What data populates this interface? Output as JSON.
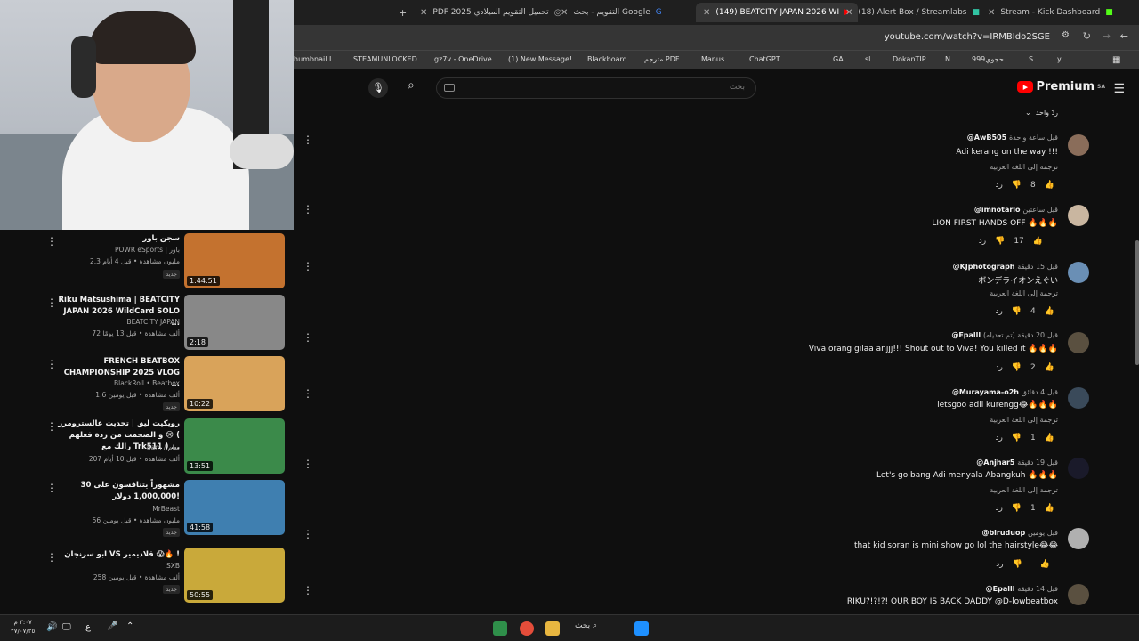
{
  "browser": {
    "tabs": [
      {
        "label": "PDF 2025 تحميل التقويم الميلادي",
        "close": "✕"
      },
      {
        "label": "التقويم - بحث Google",
        "close": "✕"
      },
      {
        "label": "(149) BEATCITY JAPAN 2026 WI",
        "close": "✕"
      },
      {
        "label": "(18) Alert Box / Streamlabs",
        "close": "✕"
      },
      {
        "label": "Stream - Kick Dashboard",
        "close": "✕"
      }
    ],
    "new_tab": "+",
    "url": "youtube.com/watch?v=IRMBIdo2SGE",
    "bookmarks": [
      "humbnail I...",
      "STEAMUNLOCKED",
      "gz7v - OneDrive",
      "(1) New Message!",
      "Blackboard",
      "مترجم PDF",
      "Manus",
      "ChatGPT",
      "GA",
      "sl",
      "DokanTIP",
      "N",
      "999حجوي",
      "S",
      "y"
    ]
  },
  "youtube": {
    "search_placeholder": "بحث",
    "logo_text": "Premium",
    "logo_region": "SA",
    "replies_toggle": "ردّ واحد",
    "comments": [
      {
        "author": "@AwB505",
        "time": "قبل ساعة واحدة",
        "text": "Adi kerang on the way !!!",
        "translate": "ترجمة إلى اللغة العربية",
        "likes": "8",
        "reply": "رد",
        "avatar_color": "#8a6d5a"
      },
      {
        "author": "@imnotarlo",
        "time": "قبل ساعتين",
        "text": "LION FIRST HANDS OFF 🔥🔥🔥",
        "translate": "",
        "likes": "17",
        "reply": "رد",
        "avatar_color": "#c9b6a0"
      },
      {
        "author": "@KJphotograph",
        "time": "قبل 15 دقيقة",
        "text": "ボンデライオンえぐい",
        "translate": "ترجمة إلى اللغة العربية",
        "likes": "4",
        "reply": "رد",
        "avatar_color": "#6a8fb5"
      },
      {
        "author": "@Epalll",
        "time": "قبل 20 دقيقة (تم تعديله)",
        "text": "Viva orang gilaa anjjj!!! Shout out to Viva! You killed it 🔥🔥🔥",
        "translate": "",
        "likes": "2",
        "reply": "رد",
        "avatar_color": "#5a5040"
      },
      {
        "author": "@Murayama-o2h",
        "time": "قبل 4 دقائق",
        "text": "letsgoo adii kurengg😂🔥🔥🔥",
        "translate": "ترجمة إلى اللغة العربية",
        "likes": "1",
        "reply": "رد",
        "avatar_color": "#3a4a5a"
      },
      {
        "author": "@Anjhar5",
        "time": "قبل 19 دقيقة",
        "text": "Let's go bang Adi menyala Abangkuh 🔥🔥🔥",
        "translate": "ترجمة إلى اللغة العربية",
        "likes": "1",
        "reply": "رد",
        "avatar_color": "#1a1a2a"
      },
      {
        "author": "@biruduop",
        "time": "قبل يومين",
        "text": "that kid soran is mini show go lol the hairstyle😂😂",
        "translate": "",
        "likes": "",
        "reply": "رد",
        "avatar_color": "#b0b0b0"
      },
      {
        "author": "@Epalll",
        "time": "قبل 14 دقيقة",
        "text": "RIKU?!?!?! OUR BOY IS BACK DADDY @D-lowbeatbox",
        "translate": "",
        "likes": "",
        "reply": "",
        "avatar_color": "#5a5040"
      }
    ]
  },
  "sidebar": {
    "videos": [
      {
        "title": "سجن باور",
        "channel": "POWR eSports | باور",
        "meta": "2.3 مليون مشاهدة • قبل 4 أيام",
        "badge": "جديد",
        "duration": "1:44:51",
        "color": "#c4722f"
      },
      {
        "title": "Riku Matsushima | BEATCITY JAPAN 2026 WildCard SOLO ...",
        "channel": "BEATCITY JAPAN",
        "meta": "72 ألف مشاهدة • قبل 13 يومًا",
        "badge": "",
        "duration": "2:18",
        "color": "#888888"
      },
      {
        "title": "FRENCH BEATBOX CHAMPIONSHIP 2025 VLOG ...",
        "channel": "BlackRoll • Beatbox",
        "meta": "1.6 ألف مشاهدة • قبل يومين",
        "badge": "جديد",
        "duration": "10:22",
        "color": "#d9a35a"
      },
      {
        "title": "رويكيت ليق | تحديث عالسترومرز و الصحمت من ردة فعلهم 😢 ( رالك مع Trk511 ) ...",
        "channel": "Sam / سام",
        "meta": "207 ألف مشاهدة • قبل 10 أيام",
        "badge": "",
        "duration": "13:51",
        "color": "#3b8a4a"
      },
      {
        "title": "30 مشهوراً يتنافسون على 1,000,000 دولار!",
        "channel": "MrBeast",
        "meta": "56 مليون مشاهدة • قبل يومين",
        "badge": "جديد",
        "duration": "41:58",
        "color": "#3f7fb0"
      },
      {
        "title": "ابو سرنجان VS قلادیمیر 😱🔥 !",
        "channel": "SXB",
        "meta": "258 ألف مشاهدة • قبل يومين",
        "badge": "جديد",
        "duration": "50:55",
        "color": "#c9a93a"
      }
    ]
  },
  "taskbar": {
    "search_label": "بحث",
    "time": "٣:٠٧ م",
    "date": "٢٧/٠٧/٢٥",
    "lang": "ع"
  }
}
